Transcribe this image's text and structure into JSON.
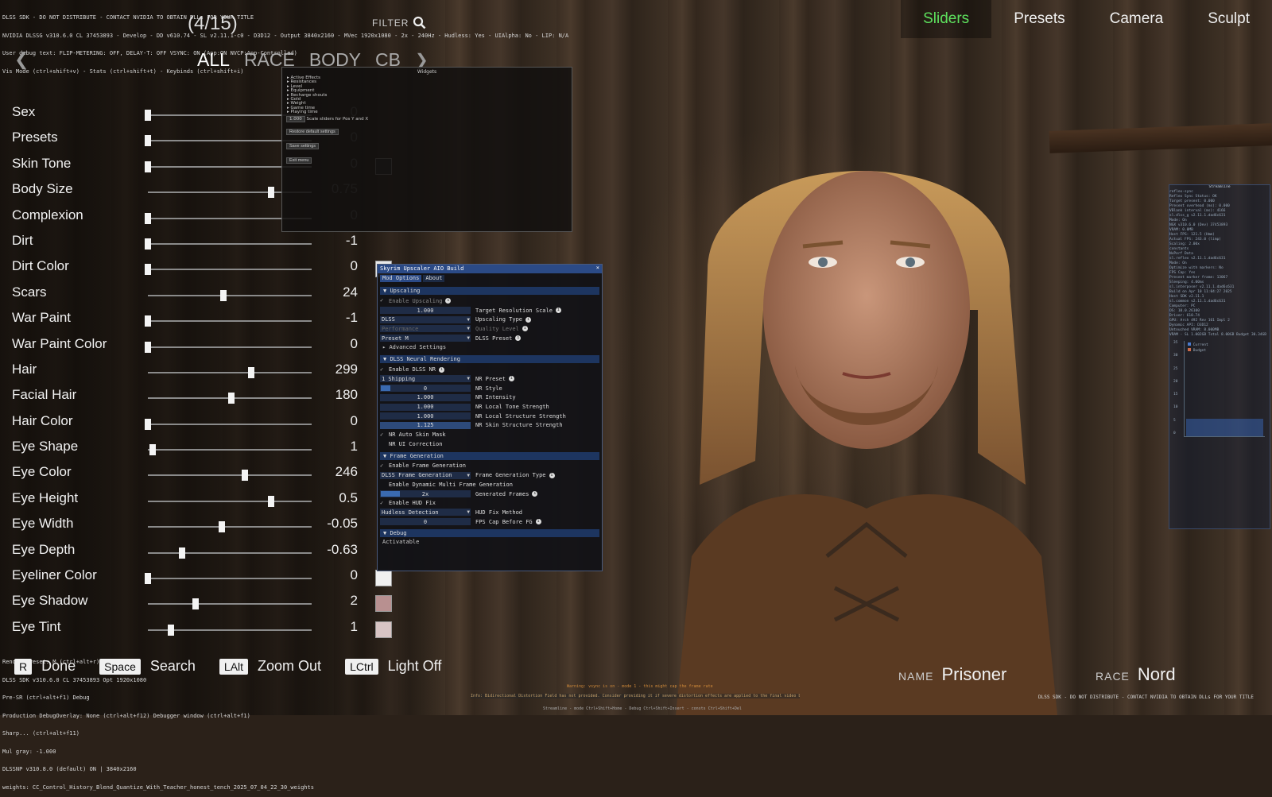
{
  "debug": {
    "top_lines": [
      "DLSS SDK - DO NOT DISTRIBUTE - CONTACT NVIDIA TO OBTAIN DLLs FOR YOUR TITLE",
      "NVIDIA DLSSG v310.6.0 CL 37453893 - Develop - DD v610.74 - SL v2.11.1-c0 - D3D12 - Output 3840x2160 - MVec 1920x1080 - 2x - 240Hz - Hudless: Yes - UIAlpha: No - LIP: N/A",
      "User debug text: FLIP-METERING: OFF, DELAY-T: OFF VSYNC: ON (App:ON NVCP:App-Controlled)",
      "Vis Mode (ctrl+shift+v) - Stats (ctrl+shift+t) - Keybinds (ctrl+shift+i)"
    ],
    "bottom_lines": [
      "Render Preset: M (ctrl+alt+r)",
      "DLSS SDK v310.6.0 CL 37453893 Opt 1920x1080",
      "Pre-SR (ctrl+alt+f1) Debug",
      "Production DebugOverlay: None (ctrl+alt+f12) Debugger window (ctrl+alt+f1)",
      "Sharp... (ctrl+alt+f11)",
      "Mul gray: -1.000",
      "DLSSNP v310.8.0 (default) ON | 3840x2160",
      "weights: CC_Control_History_Blend_Quantize_With_Teacher_honest_tench_2025_07_04_22_30_weights"
    ],
    "footer_notice": "DLSS SDK - DO NOT DISTRIBUTE - CONTACT NVIDIA TO OBTAIN DLLs FOR YOUR TITLE",
    "warning_text": "Warning: vsync is on - mode 1 - this might cap the frame rate",
    "info_text": "Info: Bidirectional Distortion Field has not provided. Consider providing it if severe distortion effects are applied to the final video buffer",
    "streamline_text": "Streamline - mode Ctrl+Shift+Home - Debug Ctrl+Shift+Insert - consts Ctrl+Shift+Del"
  },
  "top_nav": {
    "tabs": [
      {
        "label": "Sliders",
        "active": true
      },
      {
        "label": "Presets",
        "active": false
      },
      {
        "label": "Camera",
        "active": false
      },
      {
        "label": "Sculpt",
        "active": false
      }
    ]
  },
  "header": {
    "counter": "(4/15)",
    "filter_label": "FILTER",
    "categories": [
      {
        "label": "ALL",
        "active": true
      },
      {
        "label": "RACE",
        "active": false
      },
      {
        "label": "BODY",
        "active": false
      },
      {
        "label": "CB",
        "active": false
      }
    ]
  },
  "sliders": [
    {
      "label": "Sex",
      "value": "0",
      "pos": 0.0,
      "dim": true
    },
    {
      "label": "Presets",
      "value": "0",
      "pos": 0.0,
      "dim": true
    },
    {
      "label": "Skin Tone",
      "value": "0",
      "pos": 0.0,
      "dim": true,
      "swatch": "#2a2a2a"
    },
    {
      "label": "Body Size",
      "value": "0.75",
      "pos": 0.75,
      "dim": true
    },
    {
      "label": "Complexion",
      "value": "0",
      "pos": 0.0,
      "dim": true
    },
    {
      "label": "Dirt",
      "value": "-1",
      "pos": 0.0
    },
    {
      "label": "Dirt Color",
      "value": "0",
      "pos": 0.0,
      "swatch": "#e8e8e8"
    },
    {
      "label": "Scars",
      "value": "24",
      "pos": 0.46
    },
    {
      "label": "War Paint",
      "value": "-1",
      "pos": 0.0
    },
    {
      "label": "War Paint Color",
      "value": "0",
      "pos": 0.0
    },
    {
      "label": "Hair",
      "value": "299",
      "pos": 0.63
    },
    {
      "label": "Facial Hair",
      "value": "180",
      "pos": 0.51
    },
    {
      "label": "Hair Color",
      "value": "0",
      "pos": 0.0
    },
    {
      "label": "Eye Shape",
      "value": "1",
      "pos": 0.03
    },
    {
      "label": "Eye Color",
      "value": "246",
      "pos": 0.59
    },
    {
      "label": "Eye Height",
      "value": "0.5",
      "pos": 0.75
    },
    {
      "label": "Eye Width",
      "value": "-0.05",
      "pos": 0.45
    },
    {
      "label": "Eye Depth",
      "value": "-0.63",
      "pos": 0.21
    },
    {
      "label": "Eyeliner Color",
      "value": "0",
      "pos": 0.0,
      "swatch": "#f0f0f0"
    },
    {
      "label": "Eye Shadow",
      "value": "2",
      "pos": 0.29,
      "swatch": "#b89090"
    },
    {
      "label": "Eye Tint",
      "value": "1",
      "pos": 0.14,
      "swatch": "#d8c4c4"
    }
  ],
  "widgets_panel": {
    "title": "Widgets",
    "items": [
      "Active Effects",
      "Resistances",
      "Level",
      "Equipment",
      "Recharge shouts",
      "Gold",
      "Weight",
      "Game time",
      "Playing time"
    ],
    "scale_value": "1.000",
    "scale_label": "Scale sliders for Pos Y and X",
    "buttons": [
      "Restore default settings",
      "Save settings",
      "Exit menu"
    ]
  },
  "upscaler": {
    "title": "Skyrim Upscaler AIO Build",
    "tabs": [
      "Mod Options",
      "About"
    ],
    "upscaling": {
      "header": "Upscaling",
      "enable_label": "Enable Upscaling",
      "target_scale_value": "1.000",
      "target_scale_label": "Target Resolution Scale",
      "type_value": "DLSS",
      "type_label": "Upscaling Type",
      "quality_value": "Performance",
      "quality_label": "Quality Level",
      "preset_value": "Preset M",
      "preset_label": "DLSS Preset",
      "advanced": "Advanced Settings"
    },
    "nr": {
      "header": "DLSS Neural Rendering",
      "enable_label": "Enable DLSS NR",
      "preset_value": "1 Shipping",
      "preset_label": "NR Preset",
      "style_value": "0",
      "style_label": "NR Style",
      "intensity_value": "1.000",
      "intensity_label": "NR Intensity",
      "local_tone_value": "1.000",
      "local_tone_label": "NR Local Tone Strength",
      "local_structure_value": "1.000",
      "local_structure_label": "NR Local Structure Strength",
      "skin_structure_value": "1.125",
      "skin_structure_label": "NR Skin Structure Strength",
      "auto_skin_label": "NR Auto Skin Mask",
      "ui_correction_label": "NR UI Correction"
    },
    "fg": {
      "header": "Frame Generation",
      "enable_label": "Enable Frame Generation",
      "type_value": "DLSS Frame Generation",
      "type_label": "Frame Generation Type",
      "dynamic_label": "Enable Dynamic Multi Frame Generation",
      "frames_value": "2x",
      "frames_label": "Generated Frames",
      "hud_fix_label": "Enable HUD Fix",
      "hud_method_value": "Hudless Detection",
      "hud_method_label": "HUD Fix Method",
      "fps_cap_value": "0",
      "fps_cap_label": "FPS Cap Before FG"
    },
    "debug_header": "Debug",
    "debug_item": "Activatable"
  },
  "perf_overlay": {
    "title": "Streamline",
    "lines": [
      "reflex-sync",
      "Reflex Sync Status: OK",
      "Target present: 0.000",
      "Present overhead (ms): 0.000",
      "VBlank interval (ms): 4166",
      "sl.dlss_g v2.11.1.dad6c631",
      "Mode: On",
      "NGX v310.6.0 (Dev) 37453893",
      "VRAM: 0.0MB",
      "Host FPS: 121.5 (Hmm)",
      "Actual FPS: 243.0 (limp)",
      "Scaling: 2.00x",
      "constants",
      "NvPerf Data",
      "sl.reflex v2.11.1.dad6c631",
      "Mode: On",
      "Optimize with markers: No",
      "FPS Cap: Yes",
      "Present marker frame: 13067",
      "Sleeping: 4.00ms",
      "sl.interposer v2.11.1.dad6c631",
      "Build on Apr 10 11:04:27 2025",
      "Host SDK v2.11.1",
      "sl.common v2.11.1.dad6c631",
      "Computer: PC",
      "OS: 10.0.26100",
      "Driver: 610.74",
      "GPU: Arch 492 Rev 161 Impl 2",
      "Dynamic API: D3D12",
      "Untouched VRAM: 8.000MB",
      "VRAM - SL 1.002GB Total 8.00GB Budget 30.34GB"
    ],
    "legend_current": "Current",
    "legend_budget": "Budget",
    "axis": [
      "35",
      "30",
      "25",
      "20",
      "15",
      "10",
      "5",
      "0"
    ]
  },
  "bottom_bar": {
    "hints": [
      {
        "key": "R",
        "label": "Done"
      },
      {
        "key": "Space",
        "label": "Search"
      },
      {
        "key": "LAlt",
        "label": "Zoom Out"
      },
      {
        "key": "LCtrl",
        "label": "Light Off"
      }
    ],
    "name_caption": "NAME",
    "name_value": "Prisoner",
    "race_caption": "RACE",
    "race_value": "Nord"
  }
}
